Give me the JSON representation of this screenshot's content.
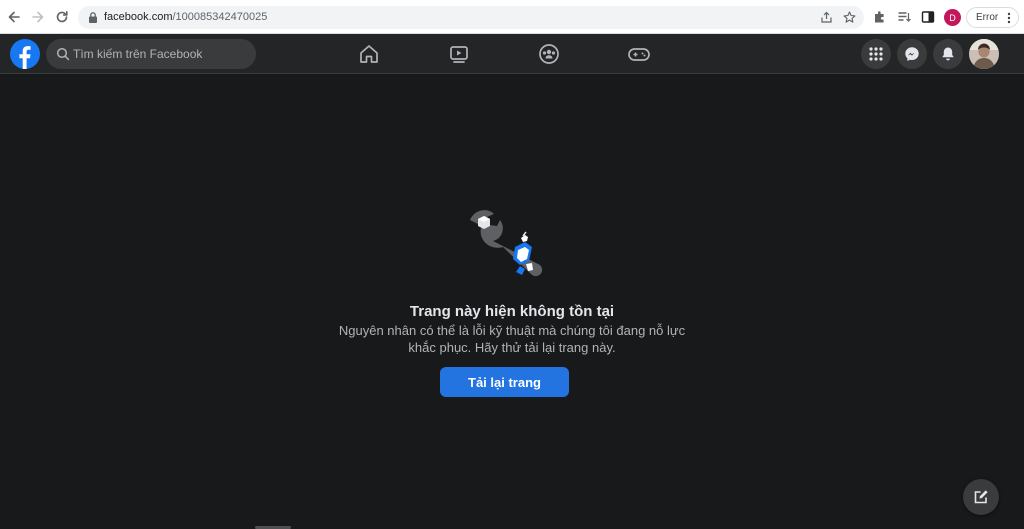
{
  "browser": {
    "url_host": "facebook.com",
    "url_path": "/100085342470025",
    "profile_initial": "D",
    "error_label": "Error"
  },
  "topbar": {
    "search_placeholder": "Tìm kiếm trên Facebook"
  },
  "main": {
    "title": "Trang này hiện không tồn tại",
    "description": "Nguyên nhân có thể là lỗi kỹ thuật mà chúng tôi đang nỗ lực khắc phục. Hãy thử tải lại trang này.",
    "reload_label": "Tải lại trang"
  },
  "colors": {
    "fb_blue": "#1877f2",
    "button_blue": "#2374e1",
    "background": "#18191a",
    "bar": "#242526"
  }
}
